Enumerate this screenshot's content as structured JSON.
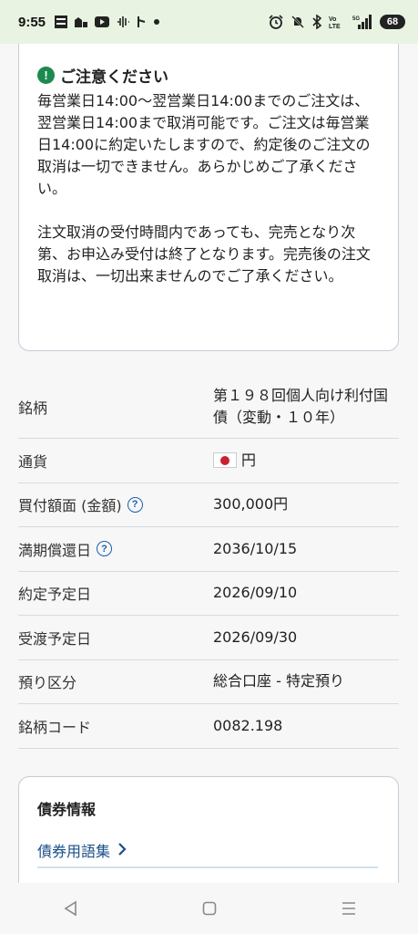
{
  "status_bar": {
    "time": "9:55",
    "battery": "68",
    "left_icons": [
      "uniqlo-icon",
      "app-icon",
      "youtube-icon",
      "audio-icon",
      "docomo-icon",
      "dot-icon"
    ],
    "right_icons": [
      "alarm-icon",
      "mute-icon",
      "bluetooth-icon",
      "volte-icon",
      "5g-signal-icon"
    ]
  },
  "notice": {
    "title": "ご注意ください",
    "para1": "毎営業日14:00〜翌営業日14:00までのご注文は、翌営業日14:00まで取消可能です。ご注文は毎営業日14:00に約定いたしますので、約定後のご注文の取消は一切できません。あらかじめご了承ください。",
    "para2": "注文取消の受付時間内であっても、完売となり次第、お申込み受付は終了となります。完売後の注文取消は、一切出来ませんのでご了承ください。"
  },
  "details": [
    {
      "label": "銘柄",
      "value": "第１９８回個人向け利付国債（変動・１０年）"
    },
    {
      "label": "通貨",
      "value": "円"
    },
    {
      "label": "買付額面 (金額)",
      "value": "300,000円"
    },
    {
      "label": "満期償還日",
      "value": "2036/10/15"
    },
    {
      "label": "約定予定日",
      "value": "2026/09/10"
    },
    {
      "label": "受渡予定日",
      "value": "2026/09/30"
    },
    {
      "label": "預り区分",
      "value": "総合口座 - 特定預り"
    },
    {
      "label": "銘柄コード",
      "value": "0082.198"
    }
  ],
  "bond_info": {
    "title": "債券情報",
    "link_label": "債券用語集"
  },
  "colors": {
    "accent_green": "#1c8a4f",
    "link_blue": "#1a4f8a",
    "status_bar_bg": "#e8f3e1"
  }
}
